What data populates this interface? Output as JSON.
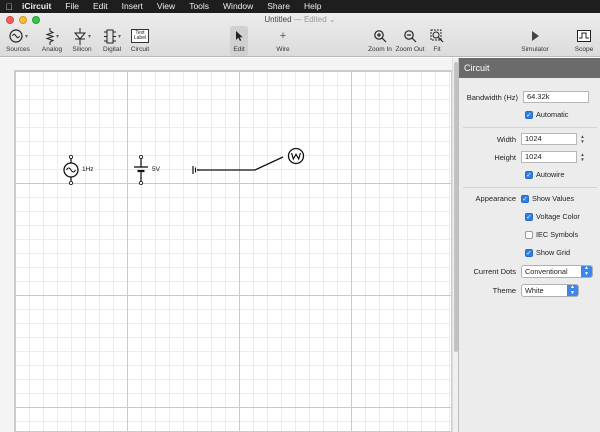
{
  "menubar": {
    "apple_icon": "apple-icon",
    "app_name": "iCircuit",
    "items": [
      "File",
      "Edit",
      "Insert",
      "View",
      "Tools",
      "Window",
      "Share",
      "Help"
    ]
  },
  "window": {
    "title": "Untitled",
    "edited": "— Edited"
  },
  "toolbar": {
    "sources": "Sources",
    "analog": "Analog",
    "silicon": "Silicon",
    "digital": "Digital",
    "circuit": "Circuit",
    "text_label_icon": "Text\nLabel",
    "edit": "Edit",
    "wire": "Wire",
    "zoom_in": "Zoom In",
    "zoom_out": "Zoom Out",
    "fit": "Fit",
    "simulator": "Simulator",
    "scope": "Scope"
  },
  "canvas": {
    "ac_source_label": "1Hz",
    "dc_source_label": "5V"
  },
  "inspector": {
    "title": "Circuit",
    "bandwidth_label": "Bandwidth (Hz)",
    "bandwidth_value": "64.32k",
    "automatic_label": "Automatic",
    "width_label": "Width",
    "width_value": "1024",
    "height_label": "Height",
    "height_value": "1024",
    "autowire_label": "Autowire",
    "appearance_label": "Appearance",
    "show_values_label": "Show Values",
    "voltage_color_label": "Voltage Color",
    "iec_symbols_label": "IEC Symbols",
    "show_grid_label": "Show Grid",
    "current_dots_label": "Current Dots",
    "current_dots_value": "Conventional",
    "theme_label": "Theme",
    "theme_value": "White",
    "checks": {
      "automatic": true,
      "autowire": true,
      "show_values": true,
      "voltage_color": true,
      "iec_symbols": false,
      "show_grid": true
    }
  },
  "colors": {
    "accent": "#2f7fe0",
    "inspector_header": "#6b6b6b"
  }
}
